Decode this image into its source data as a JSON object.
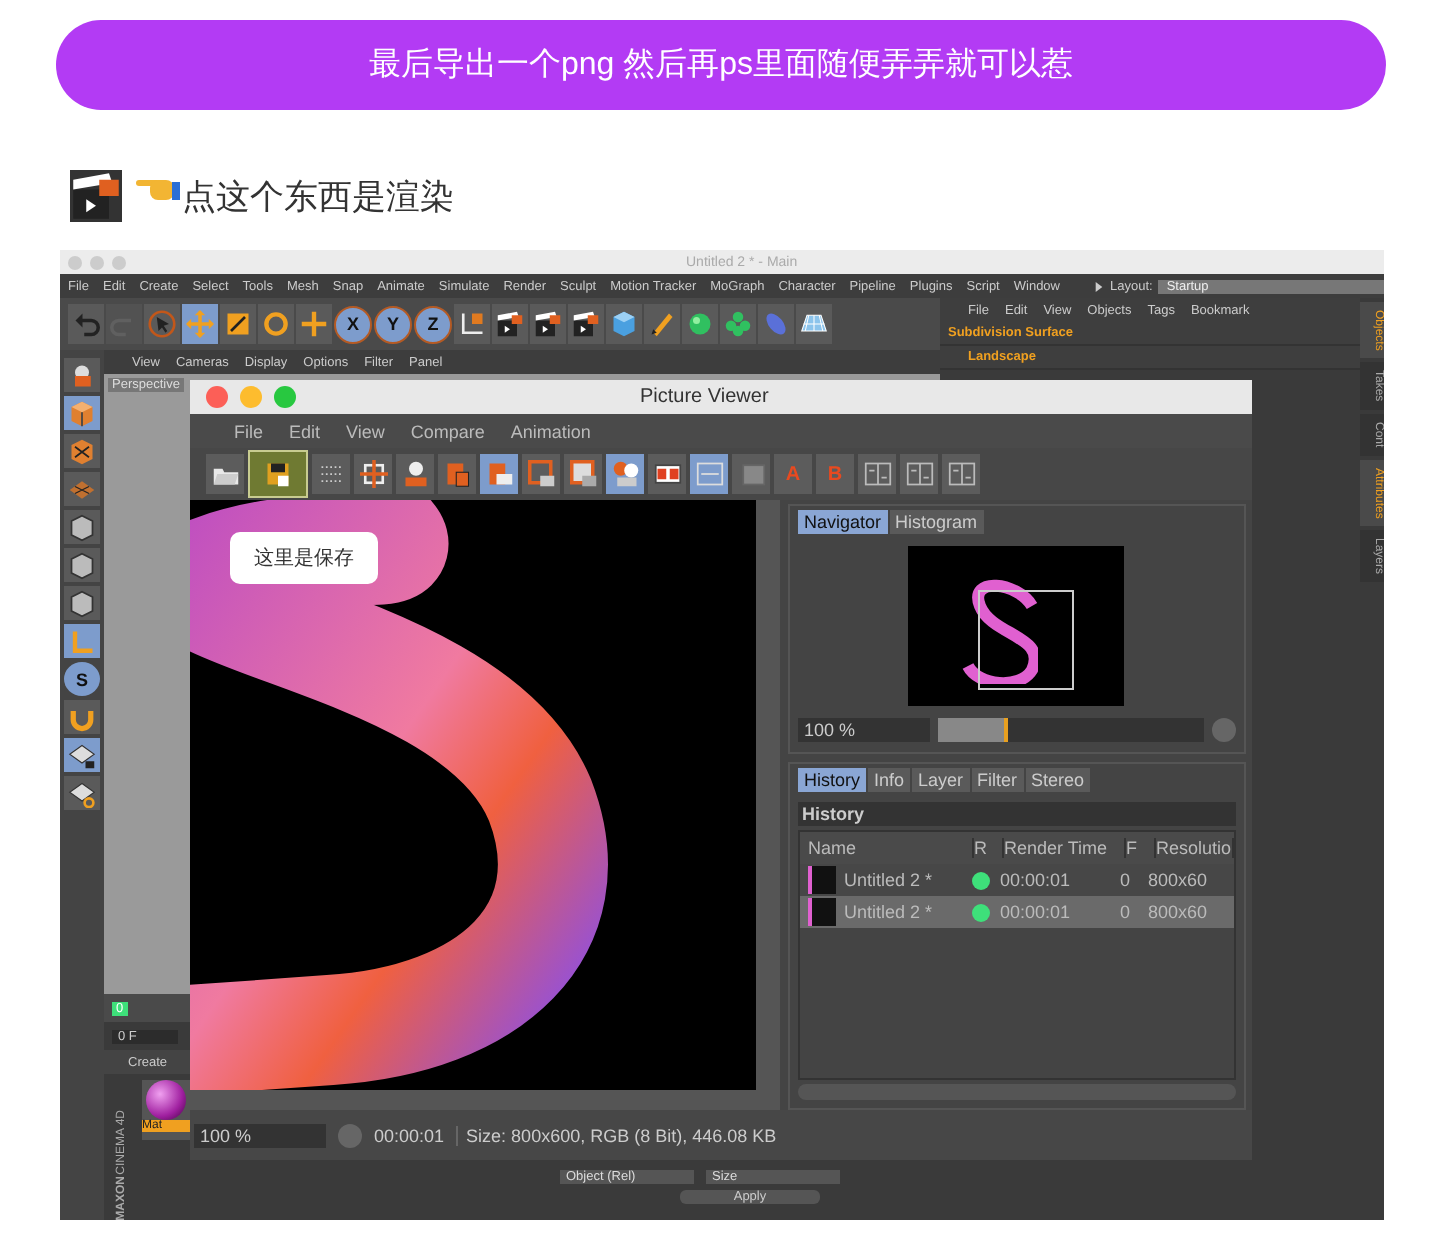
{
  "banner": {
    "text": "最后导出一个png 然后再ps里面随便弄弄就可以惹"
  },
  "caption": {
    "text": "点这个东西是渲染"
  },
  "main_window": {
    "title": "Untitled 2 * - Main",
    "menu": [
      "File",
      "Edit",
      "Create",
      "Select",
      "Tools",
      "Mesh",
      "Snap",
      "Animate",
      "Simulate",
      "Render",
      "Sculpt",
      "Motion Tracker",
      "MoGraph",
      "Character",
      "Pipeline",
      "Plugins",
      "Script",
      "Window"
    ],
    "layout_label": "Layout:",
    "layout_value": "Startup",
    "toolbar": [
      {
        "selected": false
      },
      {
        "selected": false,
        "disabled": true
      },
      {
        "selected": false
      },
      {
        "selected": true
      },
      {
        "selected": false
      },
      {
        "selected": false
      },
      {
        "selected": false
      },
      {
        "selected": true,
        "label": "X"
      },
      {
        "selected": true,
        "label": "Y"
      },
      {
        "selected": true,
        "label": "Z"
      },
      {
        "selected": false
      },
      {
        "selected": false
      },
      {
        "selected": false
      },
      {
        "selected": false
      },
      {
        "selected": false
      },
      {
        "selected": false
      },
      {
        "selected": false
      },
      {
        "selected": false
      },
      {
        "selected": false
      },
      {
        "selected": false
      }
    ],
    "side_tools": [
      {
        "selected": false
      },
      {
        "selected": true
      },
      {
        "selected": false
      },
      {
        "selected": false
      },
      {
        "selected": false
      },
      {
        "selected": false
      },
      {
        "selected": false
      },
      {
        "selected": true
      },
      {
        "selected": true,
        "label": "S"
      },
      {
        "selected": false
      },
      {
        "selected": true
      },
      {
        "selected": false
      }
    ],
    "viewport_menu": [
      "View",
      "Cameras",
      "Display",
      "Options",
      "Filter",
      "Panel"
    ],
    "viewport_label": "Perspective",
    "timeline_frame": "0",
    "frame_field": "0 F",
    "material_menu": [
      "Create"
    ],
    "material_name": "Mat",
    "logo": [
      "MAXON",
      "CINEMA 4D"
    ],
    "coord_dropdowns": [
      "Object (Rel)",
      "Size"
    ],
    "apply_button": "Apply",
    "object_menu": [
      "File",
      "Edit",
      "View",
      "Objects",
      "Tags",
      "Bookmark"
    ],
    "objects": [
      {
        "name": "Subdivision Surface",
        "children": [
          {
            "name": "Landscape"
          }
        ]
      }
    ],
    "side_tabs": [
      {
        "label": "Objects",
        "selected": true
      },
      {
        "label": "Takes",
        "selected": false
      },
      {
        "label": "Cont",
        "selected": false
      },
      {
        "label": "Attributes",
        "selected": true
      },
      {
        "label": "Layers",
        "selected": false
      }
    ]
  },
  "picture_viewer": {
    "title": "Picture Viewer",
    "menu": [
      "File",
      "Edit",
      "View",
      "Compare",
      "Animation"
    ],
    "toolbar": [
      {
        "selected": false
      },
      {
        "selected": true
      },
      {
        "selected": false
      },
      {
        "selected": false
      },
      {
        "selected": false
      },
      {
        "selected": false
      },
      {
        "selected": true
      },
      {
        "selected": false
      },
      {
        "selected": false
      },
      {
        "selected": true
      },
      {
        "selected": false
      },
      {
        "selected": true
      },
      {
        "selected": false
      },
      {
        "selected": false,
        "label": "A"
      },
      {
        "selected": false,
        "label": "B"
      },
      {
        "selected": false
      },
      {
        "selected": false
      },
      {
        "selected": false
      }
    ],
    "tooltip": "这里是保存",
    "nav_tabs": [
      {
        "label": "Navigator",
        "selected": true
      },
      {
        "label": "Histogram",
        "selected": false
      }
    ],
    "zoom": {
      "value": "100 %",
      "level": 0.25
    },
    "history_tabs": [
      {
        "label": "History",
        "selected": true
      },
      {
        "label": "Info",
        "selected": false
      },
      {
        "label": "Layer",
        "selected": false
      },
      {
        "label": "Filter",
        "selected": false
      },
      {
        "label": "Stereo",
        "selected": false
      }
    ],
    "history_title": "History",
    "columns": [
      "Name",
      "R",
      "Render Time",
      "F",
      "Resolutio"
    ],
    "rows": [
      {
        "name": "Untitled 2 *",
        "color": "#3ee07a",
        "time": "00:00:01",
        "frame": "0",
        "resolution": "800x60",
        "selected": false
      },
      {
        "name": "Untitled 2 *",
        "color": "#3ee07a",
        "time": "00:00:01",
        "frame": "0",
        "resolution": "800x60",
        "selected": true
      }
    ],
    "status": {
      "zoom": "100 %",
      "time": "00:00:01",
      "info": "Size: 800x600, RGB (8 Bit), 446.08 KB"
    }
  }
}
